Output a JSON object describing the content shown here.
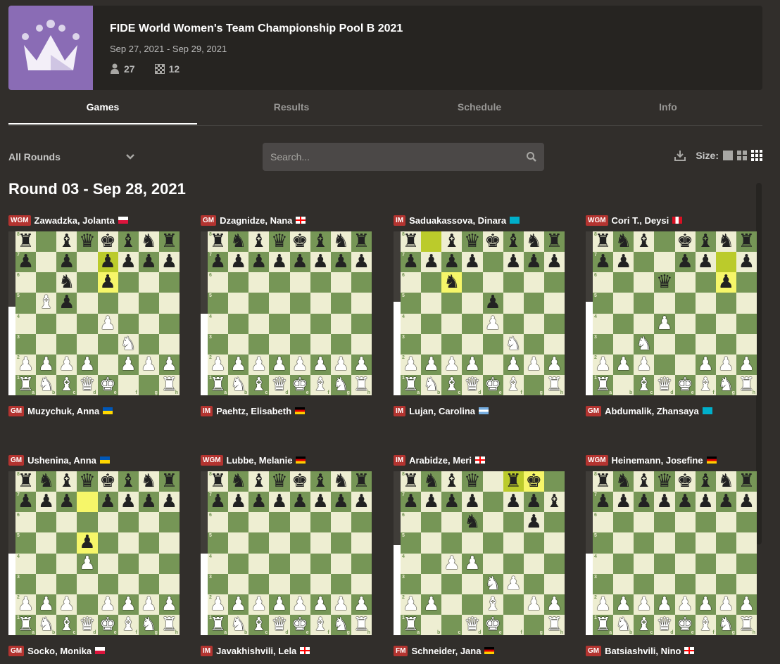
{
  "event": {
    "title": "FIDE World Women's Team Championship Pool B 2021",
    "dates": "Sep 27, 2021 - Sep 29, 2021",
    "players": "27",
    "games": "12",
    "logo_color": "#8a6cb5"
  },
  "tabs": [
    {
      "label": "Games",
      "active": true
    },
    {
      "label": "Results",
      "active": false
    },
    {
      "label": "Schedule",
      "active": false
    },
    {
      "label": "Info",
      "active": false
    }
  ],
  "filters": {
    "rounds_label": "All Rounds",
    "search_placeholder": "Search...",
    "size_label": "Size:"
  },
  "round_title": "Round 03 - Sep 28, 2021",
  "colors": {
    "light": "#eeeed2",
    "dark": "#769656",
    "badge": "#b33430",
    "bg": "#312e2b"
  },
  "games": [
    {
      "top": {
        "title": "WGM",
        "name": "Zawadzka, Jolanta",
        "flag": "poland-flag"
      },
      "bottom": {
        "title": "GM",
        "name": "Muzychuk, Anna",
        "flag": "ukraine-flag"
      },
      "eval_white_pct": 0.54,
      "highlights": [
        "e7",
        "e6"
      ],
      "position": [
        "r.bqkbnr",
        "p.p.pppp",
        "..n.p...",
        ".Bp.....",
        "....P...",
        ".....N..",
        "PPPP.PPP",
        "RNBQK..R"
      ]
    },
    {
      "top": {
        "title": "GM",
        "name": "Dzagnidze, Nana",
        "flag": "georgia-flag"
      },
      "bottom": {
        "title": "IM",
        "name": "Paehtz, Elisabeth",
        "flag": "germany-flag"
      },
      "eval_white_pct": 0.5,
      "highlights": [],
      "position": [
        "rnbqkbnr",
        "pppppppp",
        "........",
        "........",
        "........",
        "........",
        "PPPPPPPP",
        "RNBQKBNR"
      ]
    },
    {
      "top": {
        "title": "IM",
        "name": "Saduakassova, Dinara",
        "flag": "kazakhstan-flag"
      },
      "bottom": {
        "title": "IM",
        "name": "Lujan, Carolina",
        "flag": "argentina-flag"
      },
      "eval_white_pct": 0.57,
      "highlights": [
        "b8",
        "c6"
      ],
      "position": [
        "r.bqkbnr",
        "pppp.ppp",
        "..n.....",
        "....p...",
        "....P...",
        ".....N..",
        "PPPP.PPP",
        "RNBQKB.R"
      ]
    },
    {
      "top": {
        "title": "WGM",
        "name": "Cori T., Deysi",
        "flag": "peru-flag"
      },
      "bottom": {
        "title": "GM",
        "name": "Abdumalik, Zhansaya",
        "flag": "kazakhstan-flag"
      },
      "eval_white_pct": 0.57,
      "highlights": [
        "g7",
        "g6"
      ],
      "position": [
        "rnb.kbnr",
        "pp..pp.p",
        "...q..p.",
        "........",
        "...P....",
        "..N.....",
        "PPP..PPP",
        "R.BQKBNR"
      ]
    },
    {
      "top": {
        "title": "GM",
        "name": "Ushenina, Anna",
        "flag": "ukraine-flag"
      },
      "bottom": {
        "title": "GM",
        "name": "Socko, Monika",
        "flag": "poland-flag"
      },
      "eval_white_pct": 0.5,
      "highlights": [
        "d7",
        "d5"
      ],
      "position": [
        "rnbqkbnr",
        "ppp.pppp",
        "........",
        "...p....",
        "...P....",
        "........",
        "PPP.PPPP",
        "RNBQKBNR"
      ]
    },
    {
      "top": {
        "title": "WGM",
        "name": "Lubbe, Melanie",
        "flag": "germany-flag"
      },
      "bottom": {
        "title": "IM",
        "name": "Javakhishvili, Lela",
        "flag": "georgia-flag"
      },
      "eval_white_pct": 0.5,
      "highlights": [],
      "position": [
        "rnbqkbnr",
        "pppppppp",
        "........",
        "........",
        "........",
        "........",
        "PPPPPPPP",
        "RNBQKBNR"
      ]
    },
    {
      "top": {
        "title": "IM",
        "name": "Arabidze, Meri",
        "flag": "georgia-flag"
      },
      "bottom": {
        "title": "FM",
        "name": "Schneider, Jana",
        "flag": "germany-flag"
      },
      "eval_white_pct": 0.55,
      "highlights": [
        "f8",
        "g8"
      ],
      "position": [
        "rnbq.rk.",
        "pppp.ppb",
        "...n..p.",
        "........",
        "..PP....",
        "....NP..",
        "PP..B.PP",
        "R..QK..R"
      ]
    },
    {
      "top": {
        "title": "WGM",
        "name": "Heinemann, Josefine",
        "flag": "germany-flag"
      },
      "bottom": {
        "title": "GM",
        "name": "Batsiashvili, Nino",
        "flag": "georgia-flag"
      },
      "eval_white_pct": 0.5,
      "highlights": [],
      "position": [
        "rnbqkbnr",
        "pppppppp",
        "........",
        "........",
        "........",
        "........",
        "PPPPPPPP",
        "RNBQKBNR"
      ]
    }
  ]
}
